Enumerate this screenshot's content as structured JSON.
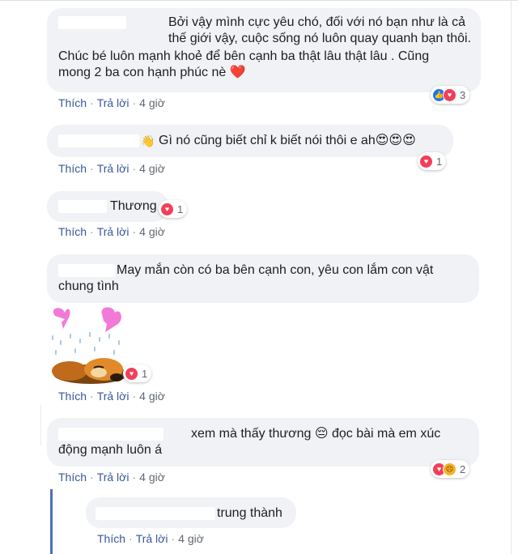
{
  "comments": [
    {
      "text": "Bởi vậy mình cực yêu chó, đối với nó bạn như là cả thế giới vậy, cuộc sống nó luôn quay quanh bạn thôi.",
      "text2": "Chúc bé luôn mạnh khoẻ để bên cạnh ba thật lâu thật lâu . Cũng mong 2 ba con hạnh phúc nè ❤️",
      "actions": {
        "like": "Thích",
        "reply": "Trả lời",
        "time": "4 giờ"
      },
      "reaction_count": "3",
      "reaction_icons": [
        "like-icon",
        "love-icon"
      ]
    },
    {
      "text": "Gì nó cũng biết chỉ k biết nói thôi e ah😍😍😍",
      "wave": "👋",
      "actions": {
        "like": "Thích",
        "reply": "Trả lời",
        "time": "4 giờ"
      },
      "reaction_count": "1",
      "reaction_icons": [
        "love-icon"
      ]
    },
    {
      "text": "Thương",
      "actions": {
        "like": "Thích",
        "reply": "Trả lời",
        "time": "4 giờ"
      },
      "reaction_count": "1",
      "reaction_icons": [
        "love-icon"
      ]
    },
    {
      "text": "May mắn còn có ba bên cạnh con, yêu con lắm con vật chung tình",
      "actions": {
        "like": "Thích",
        "reply": "Trả lời",
        "time": "4 giờ"
      },
      "reaction_count": "1",
      "reaction_icons": [
        "love-icon"
      ]
    },
    {
      "text": "xem mà thấy thương 😔 đọc bài mà em xúc động mạnh luôn á",
      "actions": {
        "like": "Thích",
        "reply": "Trả lời",
        "time": "4 giờ"
      },
      "reaction_count": "2",
      "reaction_icons": [
        "love-icon",
        "sad-icon"
      ]
    }
  ],
  "reply": {
    "text": "trung thành",
    "actions": {
      "like": "Thích",
      "reply": "Trả lời",
      "time": "4 giờ"
    }
  },
  "colors": {
    "bubble": "#f0f2f5",
    "link": "#385898",
    "love": "#f33e58",
    "like": "#1877f2",
    "thread_line": "#4f6fb7"
  }
}
